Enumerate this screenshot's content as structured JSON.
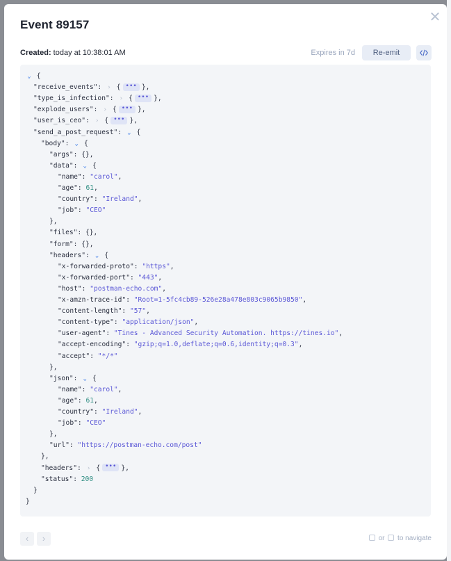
{
  "modal": {
    "title": "Event 89157",
    "close_icon": "close-icon",
    "created_label": "Created:",
    "created_value": " today at 10:38:01 AM",
    "expires": "Expires in 7d",
    "reemit_label": "Re-emit",
    "code_icon": "code-icon"
  },
  "json_lines": [
    {
      "parts": [
        {
          "t": "tog",
          "v": "⌄"
        },
        {
          "t": "p",
          "v": " {"
        }
      ]
    },
    {
      "parts": [
        {
          "t": "k",
          "v": "\"receive_events\""
        },
        {
          "t": "p",
          "v": ": "
        },
        {
          "t": "togc",
          "v": "›"
        },
        {
          "t": "p",
          "v": " {"
        },
        {
          "t": "ell",
          "v": "•••"
        },
        {
          "t": "p",
          "v": "},"
        }
      ]
    },
    {
      "parts": [
        {
          "t": "k",
          "v": "\"type_is_infection\""
        },
        {
          "t": "p",
          "v": ": "
        },
        {
          "t": "togc",
          "v": "›"
        },
        {
          "t": "p",
          "v": " {"
        },
        {
          "t": "ell",
          "v": "•••"
        },
        {
          "t": "p",
          "v": "},"
        }
      ]
    },
    {
      "parts": [
        {
          "t": "k",
          "v": "\"explode_users\""
        },
        {
          "t": "p",
          "v": ": "
        },
        {
          "t": "togc",
          "v": "›"
        },
        {
          "t": "p",
          "v": " {"
        },
        {
          "t": "ell",
          "v": "•••"
        },
        {
          "t": "p",
          "v": "},"
        }
      ]
    },
    {
      "parts": [
        {
          "t": "k",
          "v": "\"user_is_ceo\""
        },
        {
          "t": "p",
          "v": ": "
        },
        {
          "t": "togc",
          "v": "›"
        },
        {
          "t": "p",
          "v": " {"
        },
        {
          "t": "ell",
          "v": "•••"
        },
        {
          "t": "p",
          "v": "},"
        }
      ]
    },
    {
      "parts": [
        {
          "t": "k",
          "v": "\"send_a_post_request\""
        },
        {
          "t": "p",
          "v": ": "
        },
        {
          "t": "tog",
          "v": "⌄"
        },
        {
          "t": "p",
          "v": " {"
        }
      ]
    },
    {
      "parts": [
        {
          "t": "k",
          "v": "\"body\""
        },
        {
          "t": "p",
          "v": ": "
        },
        {
          "t": "tog",
          "v": "⌄"
        },
        {
          "t": "p",
          "v": " {"
        }
      ]
    },
    {
      "parts": [
        {
          "t": "k",
          "v": "\"args\""
        },
        {
          "t": "p",
          "v": ": {},"
        }
      ]
    },
    {
      "parts": [
        {
          "t": "k",
          "v": "\"data\""
        },
        {
          "t": "p",
          "v": ": "
        },
        {
          "t": "tog",
          "v": "⌄"
        },
        {
          "t": "p",
          "v": " {"
        }
      ]
    },
    {
      "parts": [
        {
          "t": "k",
          "v": "\"name\""
        },
        {
          "t": "p",
          "v": ": "
        },
        {
          "t": "s",
          "v": "\"carol\""
        },
        {
          "t": "p",
          "v": ","
        }
      ]
    },
    {
      "parts": [
        {
          "t": "k",
          "v": "\"age\""
        },
        {
          "t": "p",
          "v": ": "
        },
        {
          "t": "n",
          "v": "61"
        },
        {
          "t": "p",
          "v": ","
        }
      ]
    },
    {
      "parts": [
        {
          "t": "k",
          "v": "\"country\""
        },
        {
          "t": "p",
          "v": ": "
        },
        {
          "t": "s",
          "v": "\"Ireland\""
        },
        {
          "t": "p",
          "v": ","
        }
      ]
    },
    {
      "parts": [
        {
          "t": "k",
          "v": "\"job\""
        },
        {
          "t": "p",
          "v": ": "
        },
        {
          "t": "s",
          "v": "\"CEO\""
        }
      ]
    },
    {
      "parts": [
        {
          "t": "p",
          "v": "},"
        }
      ]
    },
    {
      "parts": [
        {
          "t": "k",
          "v": "\"files\""
        },
        {
          "t": "p",
          "v": ": {},"
        }
      ]
    },
    {
      "parts": [
        {
          "t": "k",
          "v": "\"form\""
        },
        {
          "t": "p",
          "v": ": {},"
        }
      ]
    },
    {
      "parts": [
        {
          "t": "k",
          "v": "\"headers\""
        },
        {
          "t": "p",
          "v": ": "
        },
        {
          "t": "tog",
          "v": "⌄"
        },
        {
          "t": "p",
          "v": " {"
        }
      ]
    },
    {
      "parts": [
        {
          "t": "k",
          "v": "\"x-forwarded-proto\""
        },
        {
          "t": "p",
          "v": ": "
        },
        {
          "t": "s",
          "v": "\"https\""
        },
        {
          "t": "p",
          "v": ","
        }
      ]
    },
    {
      "parts": [
        {
          "t": "k",
          "v": "\"x-forwarded-port\""
        },
        {
          "t": "p",
          "v": ": "
        },
        {
          "t": "s",
          "v": "\"443\""
        },
        {
          "t": "p",
          "v": ","
        }
      ]
    },
    {
      "parts": [
        {
          "t": "k",
          "v": "\"host\""
        },
        {
          "t": "p",
          "v": ": "
        },
        {
          "t": "s",
          "v": "\"postman-echo.com\""
        },
        {
          "t": "p",
          "v": ","
        }
      ]
    },
    {
      "parts": [
        {
          "t": "k",
          "v": "\"x-amzn-trace-id\""
        },
        {
          "t": "p",
          "v": ": "
        },
        {
          "t": "s",
          "v": "\"Root=1-5fc4cb89-526e28a478e803c9065b9850\""
        },
        {
          "t": "p",
          "v": ","
        }
      ]
    },
    {
      "parts": [
        {
          "t": "k",
          "v": "\"content-length\""
        },
        {
          "t": "p",
          "v": ": "
        },
        {
          "t": "s",
          "v": "\"57\""
        },
        {
          "t": "p",
          "v": ","
        }
      ]
    },
    {
      "parts": [
        {
          "t": "k",
          "v": "\"content-type\""
        },
        {
          "t": "p",
          "v": ": "
        },
        {
          "t": "s",
          "v": "\"application/json\""
        },
        {
          "t": "p",
          "v": ","
        }
      ]
    },
    {
      "parts": [
        {
          "t": "k",
          "v": "\"user-agent\""
        },
        {
          "t": "p",
          "v": ": "
        },
        {
          "t": "s",
          "v": "\"Tines - Advanced Security Automation. https://tines.io\""
        },
        {
          "t": "p",
          "v": ","
        }
      ]
    },
    {
      "parts": [
        {
          "t": "k",
          "v": "\"accept-encoding\""
        },
        {
          "t": "p",
          "v": ": "
        },
        {
          "t": "s",
          "v": "\"gzip;q=1.0,deflate;q=0.6,identity;q=0.3\""
        },
        {
          "t": "p",
          "v": ","
        }
      ]
    },
    {
      "parts": [
        {
          "t": "k",
          "v": "\"accept\""
        },
        {
          "t": "p",
          "v": ": "
        },
        {
          "t": "s",
          "v": "\"*/*\""
        }
      ]
    },
    {
      "parts": [
        {
          "t": "p",
          "v": "},"
        }
      ]
    },
    {
      "parts": [
        {
          "t": "k",
          "v": "\"json\""
        },
        {
          "t": "p",
          "v": ": "
        },
        {
          "t": "tog",
          "v": "⌄"
        },
        {
          "t": "p",
          "v": " {"
        }
      ]
    },
    {
      "parts": [
        {
          "t": "k",
          "v": "\"name\""
        },
        {
          "t": "p",
          "v": ": "
        },
        {
          "t": "s",
          "v": "\"carol\""
        },
        {
          "t": "p",
          "v": ","
        }
      ]
    },
    {
      "parts": [
        {
          "t": "k",
          "v": "\"age\""
        },
        {
          "t": "p",
          "v": ": "
        },
        {
          "t": "n",
          "v": "61"
        },
        {
          "t": "p",
          "v": ","
        }
      ]
    },
    {
      "parts": [
        {
          "t": "k",
          "v": "\"country\""
        },
        {
          "t": "p",
          "v": ": "
        },
        {
          "t": "s",
          "v": "\"Ireland\""
        },
        {
          "t": "p",
          "v": ","
        }
      ]
    },
    {
      "parts": [
        {
          "t": "k",
          "v": "\"job\""
        },
        {
          "t": "p",
          "v": ": "
        },
        {
          "t": "s",
          "v": "\"CEO\""
        }
      ]
    },
    {
      "parts": [
        {
          "t": "p",
          "v": "},"
        }
      ]
    },
    {
      "parts": [
        {
          "t": "k",
          "v": "\"url\""
        },
        {
          "t": "p",
          "v": ": "
        },
        {
          "t": "s",
          "v": "\"https://postman-echo.com/post\""
        }
      ]
    },
    {
      "parts": [
        {
          "t": "p",
          "v": "},"
        }
      ]
    },
    {
      "parts": [
        {
          "t": "k",
          "v": "\"headers\""
        },
        {
          "t": "p",
          "v": ": "
        },
        {
          "t": "togc",
          "v": "›"
        },
        {
          "t": "p",
          "v": " {"
        },
        {
          "t": "ell",
          "v": "•••"
        },
        {
          "t": "p",
          "v": "},"
        }
      ]
    },
    {
      "parts": [
        {
          "t": "k",
          "v": "\"status\""
        },
        {
          "t": "p",
          "v": ": "
        },
        {
          "t": "n",
          "v": "200"
        }
      ]
    },
    {
      "parts": [
        {
          "t": "p",
          "v": "}"
        }
      ]
    },
    {
      "parts": [
        {
          "t": "p",
          "v": "}"
        }
      ]
    }
  ],
  "footer": {
    "prev_icon": "chevron-left-icon",
    "next_icon": "chevron-right-icon",
    "hint_or": " or ",
    "hint_tail": " to navigate"
  },
  "colors": {
    "string": "#5a57d6",
    "number": "#2c8c80",
    "toggle": "#3b7be8",
    "panel": "#f3f5f8"
  }
}
